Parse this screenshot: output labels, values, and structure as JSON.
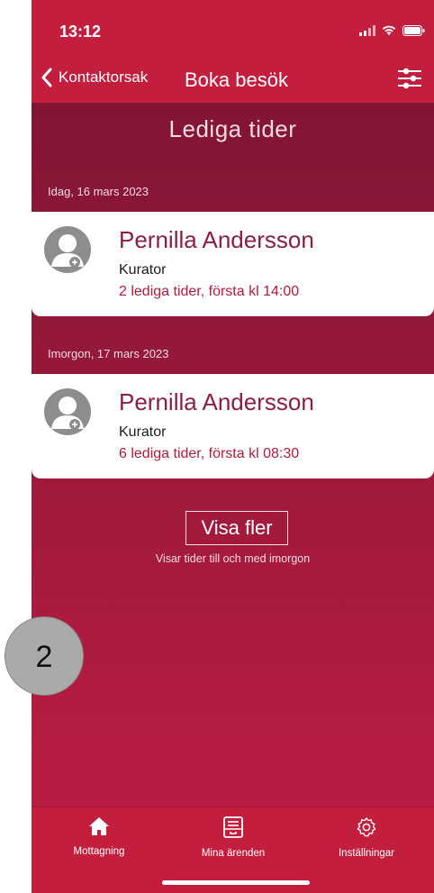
{
  "status_bar": {
    "time": "13:12"
  },
  "nav": {
    "back_label": "Kontaktorsak",
    "title": "Boka besök"
  },
  "section": {
    "title": "Lediga tider"
  },
  "groups": [
    {
      "date_label": "Idag, 16 mars 2023",
      "name": "Pernilla Andersson",
      "role": "Kurator",
      "slots": "2 lediga tider, första kl 14:00"
    },
    {
      "date_label": "Imorgon, 17 mars 2023",
      "name": "Pernilla Andersson",
      "role": "Kurator",
      "slots": "6 lediga tider, första kl 08:30"
    }
  ],
  "show_more": {
    "label": "Visa fler",
    "subtitle": "Visar tider till och med imorgon"
  },
  "tabs": [
    {
      "label": "Mottagning",
      "icon": "home-icon"
    },
    {
      "label": "Mina ärenden",
      "icon": "inbox-icon"
    },
    {
      "label": "Inställningar",
      "icon": "gear-icon"
    }
  ],
  "step_badge": "2",
  "colors": {
    "accent": "#c41e3f",
    "background_top": "#7b1332",
    "card": "#ffffff",
    "name_text": "#8a1f3f",
    "slots_text": "#b01c3c"
  }
}
